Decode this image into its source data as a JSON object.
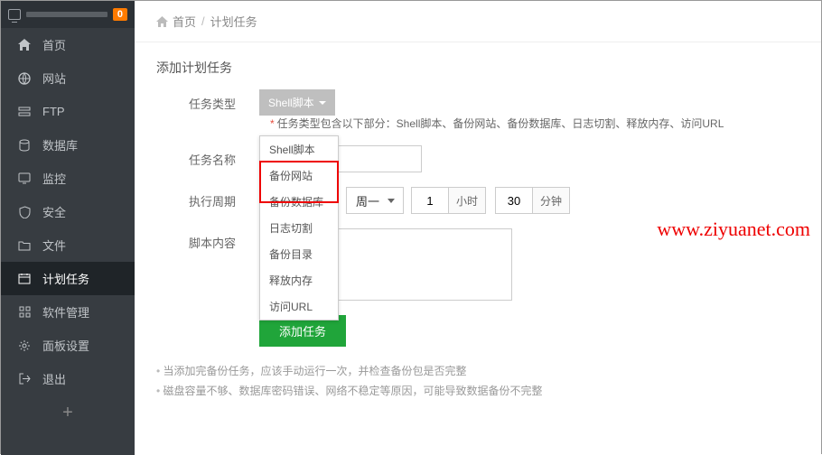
{
  "top": {
    "badge": "0"
  },
  "sidebar": {
    "items": [
      {
        "label": "首页",
        "icon": "home-icon"
      },
      {
        "label": "网站",
        "icon": "globe-icon"
      },
      {
        "label": "FTP",
        "icon": "ftp-icon"
      },
      {
        "label": "数据库",
        "icon": "database-icon"
      },
      {
        "label": "监控",
        "icon": "monitor-icon"
      },
      {
        "label": "安全",
        "icon": "shield-icon"
      },
      {
        "label": "文件",
        "icon": "folder-icon"
      },
      {
        "label": "计划任务",
        "icon": "calendar-icon",
        "active": true
      },
      {
        "label": "软件管理",
        "icon": "grid-icon"
      },
      {
        "label": "面板设置",
        "icon": "gear-icon"
      },
      {
        "label": "退出",
        "icon": "logout-icon"
      }
    ],
    "plus": "+"
  },
  "breadcrumb": {
    "home": "首页",
    "current": "计划任务"
  },
  "section_title": "添加计划任务",
  "form": {
    "task_type_label": "任务类型",
    "task_type_btn": "Shell脚本",
    "task_type_note": "任务类型包含以下部分：Shell脚本、备份网站、备份数据库、日志切割、释放内存、访问URL",
    "task_name_label": "任务名称",
    "task_name_value": "",
    "cycle_label": "执行周期",
    "cycle_day": "周一",
    "cycle_hour": "1",
    "cycle_hour_unit": "小时",
    "cycle_min": "30",
    "cycle_min_unit": "分钟",
    "script_label": "脚本内容",
    "script_value": "",
    "submit": "添加任务",
    "dropdown_opts": [
      "Shell脚本",
      "备份网站",
      "备份数据库",
      "日志切割",
      "备份目录",
      "释放内存",
      "访问URL"
    ]
  },
  "tips": [
    "当添加完备份任务，应该手动运行一次，并检查备份包是否完整",
    "磁盘容量不够、数据库密码错误、网络不稳定等原因，可能导致数据备份不完整"
  ],
  "watermark": "www.ziyuanet.com"
}
